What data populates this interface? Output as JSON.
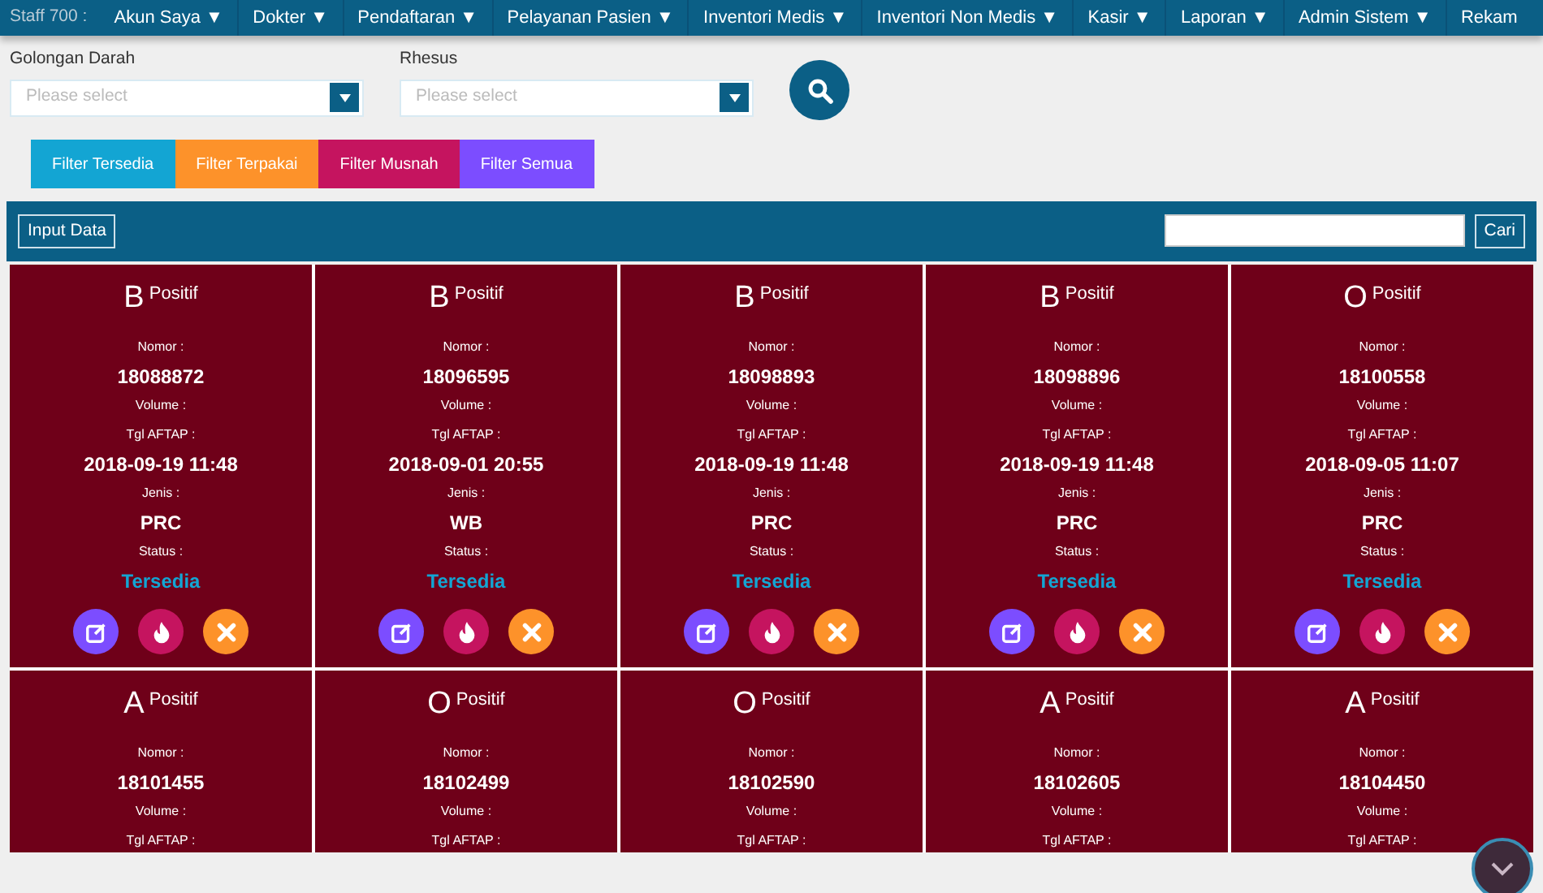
{
  "navbar": {
    "user_label": "Staff 700 :",
    "items": [
      {
        "label": "Akun Saya",
        "caret": "▼"
      },
      {
        "label": "Dokter",
        "caret": "▼"
      },
      {
        "label": "Pendaftaran",
        "caret": "▼"
      },
      {
        "label": "Pelayanan Pasien",
        "caret": "▼"
      },
      {
        "label": "Inventori Medis",
        "caret": "▼"
      },
      {
        "label": "Inventori Non Medis",
        "caret": "▼"
      },
      {
        "label": "Kasir",
        "caret": "▼"
      },
      {
        "label": "Laporan",
        "caret": "▼"
      },
      {
        "label": "Admin Sistem",
        "caret": "▼"
      },
      {
        "label": "Rekam"
      }
    ]
  },
  "filters": [
    {
      "label": "Golongan Darah",
      "placeholder": "Please select"
    },
    {
      "label": "Rhesus",
      "placeholder": "Please select"
    }
  ],
  "filter_buttons": [
    {
      "label": "Filter Tersedia",
      "color": "#13a5d3"
    },
    {
      "label": "Filter Terpakai",
      "color": "#fd922a"
    },
    {
      "label": "Filter Musnah",
      "color": "#c5145f"
    },
    {
      "label": "Filter Semua",
      "color": "#7c4dff"
    }
  ],
  "toolbar": {
    "input_button": "Input Data",
    "search_button": "Cari"
  },
  "cards": [
    {
      "group": "B",
      "rhesus": "Positif",
      "lines": [
        {
          "kind": "label",
          "text": "Nomor :"
        },
        {
          "kind": "value",
          "text": "18088872"
        },
        {
          "kind": "label",
          "text": "Volume :"
        },
        {
          "kind": "label",
          "text": "Tgl AFTAP :"
        },
        {
          "kind": "value",
          "text": "2018-09-19 11:48"
        },
        {
          "kind": "label",
          "text": "Jenis :"
        },
        {
          "kind": "value",
          "text": "PRC"
        },
        {
          "kind": "label",
          "text": "Status :"
        },
        {
          "kind": "status",
          "text": "Tersedia"
        }
      ],
      "actions": [
        {
          "kind": "edit"
        },
        {
          "kind": "burn"
        },
        {
          "kind": "delete"
        }
      ]
    },
    {
      "group": "B",
      "rhesus": "Positif",
      "lines": [
        {
          "kind": "label",
          "text": "Nomor :"
        },
        {
          "kind": "value",
          "text": "18096595"
        },
        {
          "kind": "label",
          "text": "Volume :"
        },
        {
          "kind": "label",
          "text": "Tgl AFTAP :"
        },
        {
          "kind": "value",
          "text": "2018-09-01 20:55"
        },
        {
          "kind": "label",
          "text": "Jenis :"
        },
        {
          "kind": "value",
          "text": "WB"
        },
        {
          "kind": "label",
          "text": "Status :"
        },
        {
          "kind": "status",
          "text": "Tersedia"
        }
      ],
      "actions": [
        {
          "kind": "edit"
        },
        {
          "kind": "burn"
        },
        {
          "kind": "delete"
        }
      ]
    },
    {
      "group": "B",
      "rhesus": "Positif",
      "lines": [
        {
          "kind": "label",
          "text": "Nomor :"
        },
        {
          "kind": "value",
          "text": "18098893"
        },
        {
          "kind": "label",
          "text": "Volume :"
        },
        {
          "kind": "label",
          "text": "Tgl AFTAP :"
        },
        {
          "kind": "value",
          "text": "2018-09-19 11:48"
        },
        {
          "kind": "label",
          "text": "Jenis :"
        },
        {
          "kind": "value",
          "text": "PRC"
        },
        {
          "kind": "label",
          "text": "Status :"
        },
        {
          "kind": "status",
          "text": "Tersedia"
        }
      ],
      "actions": [
        {
          "kind": "edit"
        },
        {
          "kind": "burn"
        },
        {
          "kind": "delete"
        }
      ]
    },
    {
      "group": "B",
      "rhesus": "Positif",
      "lines": [
        {
          "kind": "label",
          "text": "Nomor :"
        },
        {
          "kind": "value",
          "text": "18098896"
        },
        {
          "kind": "label",
          "text": "Volume :"
        },
        {
          "kind": "label",
          "text": "Tgl AFTAP :"
        },
        {
          "kind": "value",
          "text": "2018-09-19 11:48"
        },
        {
          "kind": "label",
          "text": "Jenis :"
        },
        {
          "kind": "value",
          "text": "PRC"
        },
        {
          "kind": "label",
          "text": "Status :"
        },
        {
          "kind": "status",
          "text": "Tersedia"
        }
      ],
      "actions": [
        {
          "kind": "edit"
        },
        {
          "kind": "burn"
        },
        {
          "kind": "delete"
        }
      ]
    },
    {
      "group": "O",
      "rhesus": "Positif",
      "lines": [
        {
          "kind": "label",
          "text": "Nomor :"
        },
        {
          "kind": "value",
          "text": "18100558"
        },
        {
          "kind": "label",
          "text": "Volume :"
        },
        {
          "kind": "label",
          "text": "Tgl AFTAP :"
        },
        {
          "kind": "value",
          "text": "2018-09-05 11:07"
        },
        {
          "kind": "label",
          "text": "Jenis :"
        },
        {
          "kind": "value",
          "text": "PRC"
        },
        {
          "kind": "label",
          "text": "Status :"
        },
        {
          "kind": "status",
          "text": "Tersedia"
        }
      ],
      "actions": [
        {
          "kind": "edit"
        },
        {
          "kind": "burn"
        },
        {
          "kind": "delete"
        }
      ]
    },
    {
      "group": "A",
      "rhesus": "Positif",
      "lines": [
        {
          "kind": "label",
          "text": "Nomor :"
        },
        {
          "kind": "value",
          "text": "18101455"
        },
        {
          "kind": "label",
          "text": "Volume :"
        },
        {
          "kind": "label",
          "text": "Tgl AFTAP :"
        }
      ]
    },
    {
      "group": "O",
      "rhesus": "Positif",
      "lines": [
        {
          "kind": "label",
          "text": "Nomor :"
        },
        {
          "kind": "value",
          "text": "18102499"
        },
        {
          "kind": "label",
          "text": "Volume :"
        },
        {
          "kind": "label",
          "text": "Tgl AFTAP :"
        }
      ]
    },
    {
      "group": "O",
      "rhesus": "Positif",
      "lines": [
        {
          "kind": "label",
          "text": "Nomor :"
        },
        {
          "kind": "value",
          "text": "18102590"
        },
        {
          "kind": "label",
          "text": "Volume :"
        },
        {
          "kind": "label",
          "text": "Tgl AFTAP :"
        }
      ]
    },
    {
      "group": "A",
      "rhesus": "Positif",
      "lines": [
        {
          "kind": "label",
          "text": "Nomor :"
        },
        {
          "kind": "value",
          "text": "18102605"
        },
        {
          "kind": "label",
          "text": "Volume :"
        },
        {
          "kind": "label",
          "text": "Tgl AFTAP :"
        }
      ]
    },
    {
      "group": "A",
      "rhesus": "Positif",
      "lines": [
        {
          "kind": "label",
          "text": "Nomor :"
        },
        {
          "kind": "value",
          "text": "18104450"
        },
        {
          "kind": "label",
          "text": "Volume :"
        },
        {
          "kind": "label",
          "text": "Tgl AFTAP :"
        }
      ]
    }
  ]
}
